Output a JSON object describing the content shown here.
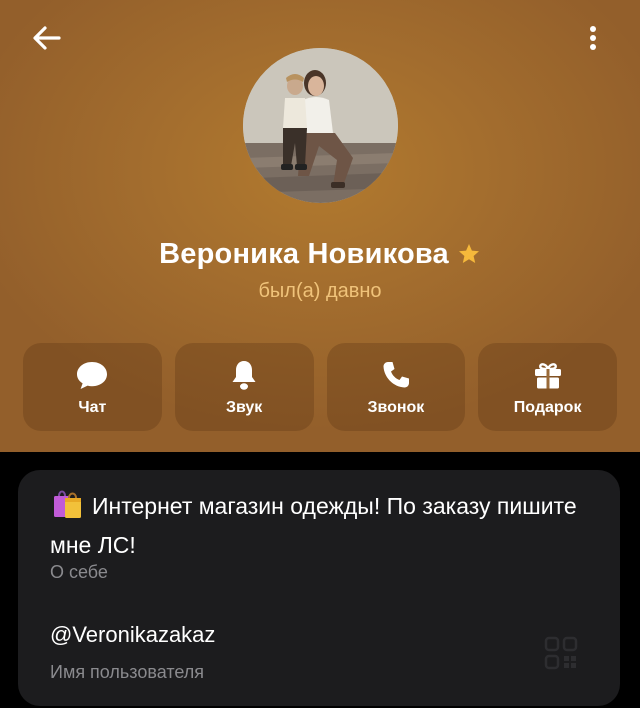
{
  "profile": {
    "name": "Вероника Новикова",
    "status": "был(а) давно"
  },
  "actions": [
    {
      "label": "Чат",
      "icon": "chat-bubble-icon"
    },
    {
      "label": "Звук",
      "icon": "bell-icon"
    },
    {
      "label": "Звонок",
      "icon": "phone-icon"
    },
    {
      "label": "Подарок",
      "icon": "gift-icon"
    }
  ],
  "info": {
    "bio": "Интернет магазин одежды! По заказу пишите мне ЛС!",
    "bio_label": "О себе",
    "username": "@Veronikazakaz",
    "username_label": "Имя пользователя"
  },
  "colors": {
    "header_bg": "#a46e2e",
    "status_text": "#f0c37a",
    "star": "#f6b93b",
    "card_bg": "#1c1c1e"
  },
  "icons": [
    "back-arrow-icon",
    "more-vertical-icon",
    "star-icon",
    "shopping-bags-emoji-icon",
    "qr-code-icon"
  ]
}
